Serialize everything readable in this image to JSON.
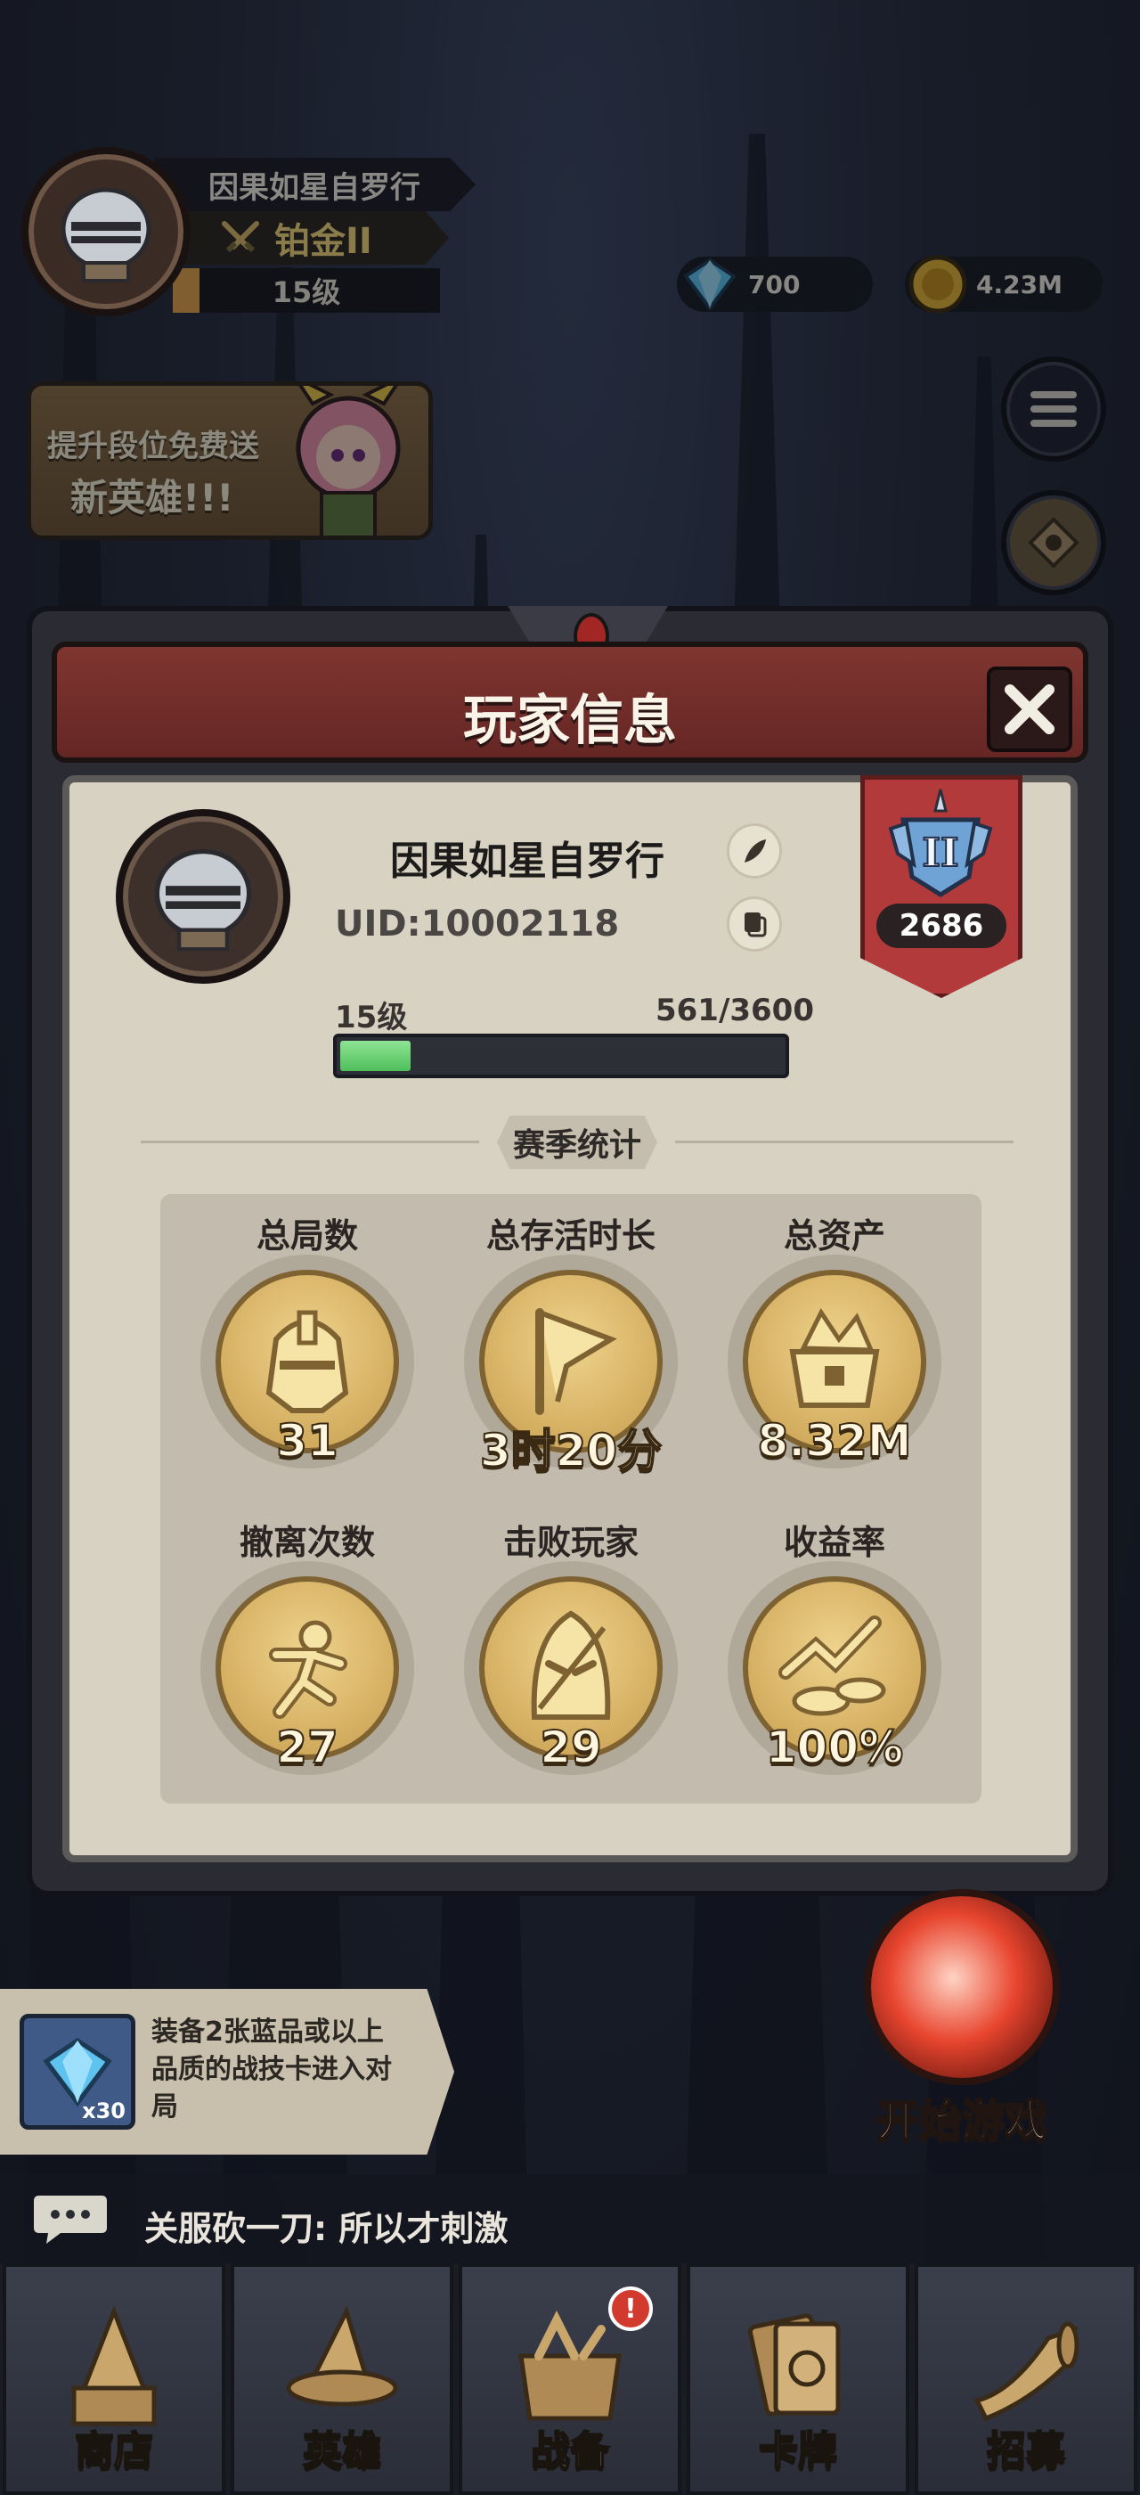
{
  "player": {
    "name": "因果如星自罗行",
    "rank": "铂金II",
    "level": "15级"
  },
  "currency": {
    "gems": "700",
    "gold": "4.23M"
  },
  "promo": {
    "line1": "提升段位免费送",
    "line2": "新英雄!!!"
  },
  "modal": {
    "title": "玩家信息",
    "name": "因果如星自罗行",
    "uid": "UID:10002118",
    "level": "15级",
    "exp_text": "561/3600",
    "exp_fraction": 0.156,
    "rank_tier": "II",
    "rank_score": "2686",
    "season_title": "赛季统计",
    "stats": [
      {
        "label": "总局数",
        "value": "31",
        "icon": "helmet-icon"
      },
      {
        "label": "总存活时长",
        "value": "3时20分",
        "icon": "flag-icon"
      },
      {
        "label": "总资产",
        "value": "8.32M",
        "icon": "treasure-chest-icon"
      },
      {
        "label": "撤离次数",
        "value": "27",
        "icon": "running-man-icon"
      },
      {
        "label": "击败玩家",
        "value": "29",
        "icon": "hooded-figure-icon"
      },
      {
        "label": "收益率",
        "value": "100%",
        "icon": "coins-growth-icon"
      }
    ]
  },
  "quest": {
    "text": "装备2张蓝品或以上品质的战技卡进入对局",
    "reward_count": "x30"
  },
  "start_label": "开始游戏",
  "chat": {
    "text": "关服砍一刀: 所以才刺激"
  },
  "nav": [
    {
      "label": "商店",
      "icon": "wizard-hat-shop-icon"
    },
    {
      "label": "英雄",
      "icon": "hero-hat-icon"
    },
    {
      "label": "战备",
      "icon": "equipment-box-icon",
      "badge": "!"
    },
    {
      "label": "卡牌",
      "icon": "cards-icon"
    },
    {
      "label": "招募",
      "icon": "horn-icon"
    }
  ],
  "colors": {
    "modal_header": "#7f3530",
    "modal_body": "#d8d2c3",
    "exp_fill": "#4fbf5c",
    "rank_banner": "#b23a3a",
    "medal_gold": "#efd38c"
  }
}
